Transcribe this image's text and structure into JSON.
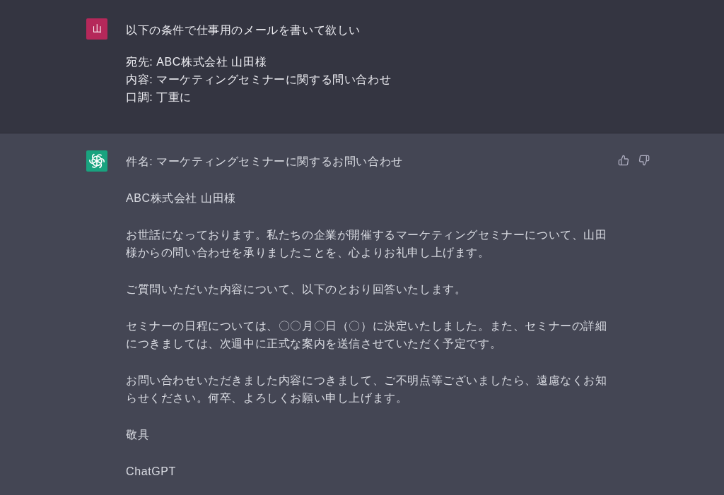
{
  "conversation": [
    {
      "kind": "user",
      "avatar": {
        "text": "山"
      },
      "request": "以下の条件で仕事用のメールを書いて欲しい",
      "details": [
        "宛先: ABC株式会社 山田様",
        "内容: マーケティングセミナーに関する問い合わせ",
        "口調: 丁重に"
      ]
    },
    {
      "kind": "assistant",
      "paragraphs": [
        "件名: マーケティングセミナーに関するお問い合わせ",
        "ABC株式会社 山田様",
        "お世話になっております。私たちの企業が開催するマーケティングセミナーについて、山田様からの問い合わせを承りましたことを、心よりお礼申し上げます。",
        "ご質問いただいた内容について、以下のとおり回答いたします。",
        "セミナーの日程については、〇〇月〇日（〇）に決定いたしました。また、セミナーの詳細につきましては、次週中に正式な案内を送信させていただく予定です。",
        "お問い合わせいただきました内容につきまして、ご不明点等ございましたら、遠慮なくお知らせください。何卒、よろしくお願い申し上げます。",
        "敬具",
        "ChatGPT"
      ]
    }
  ]
}
